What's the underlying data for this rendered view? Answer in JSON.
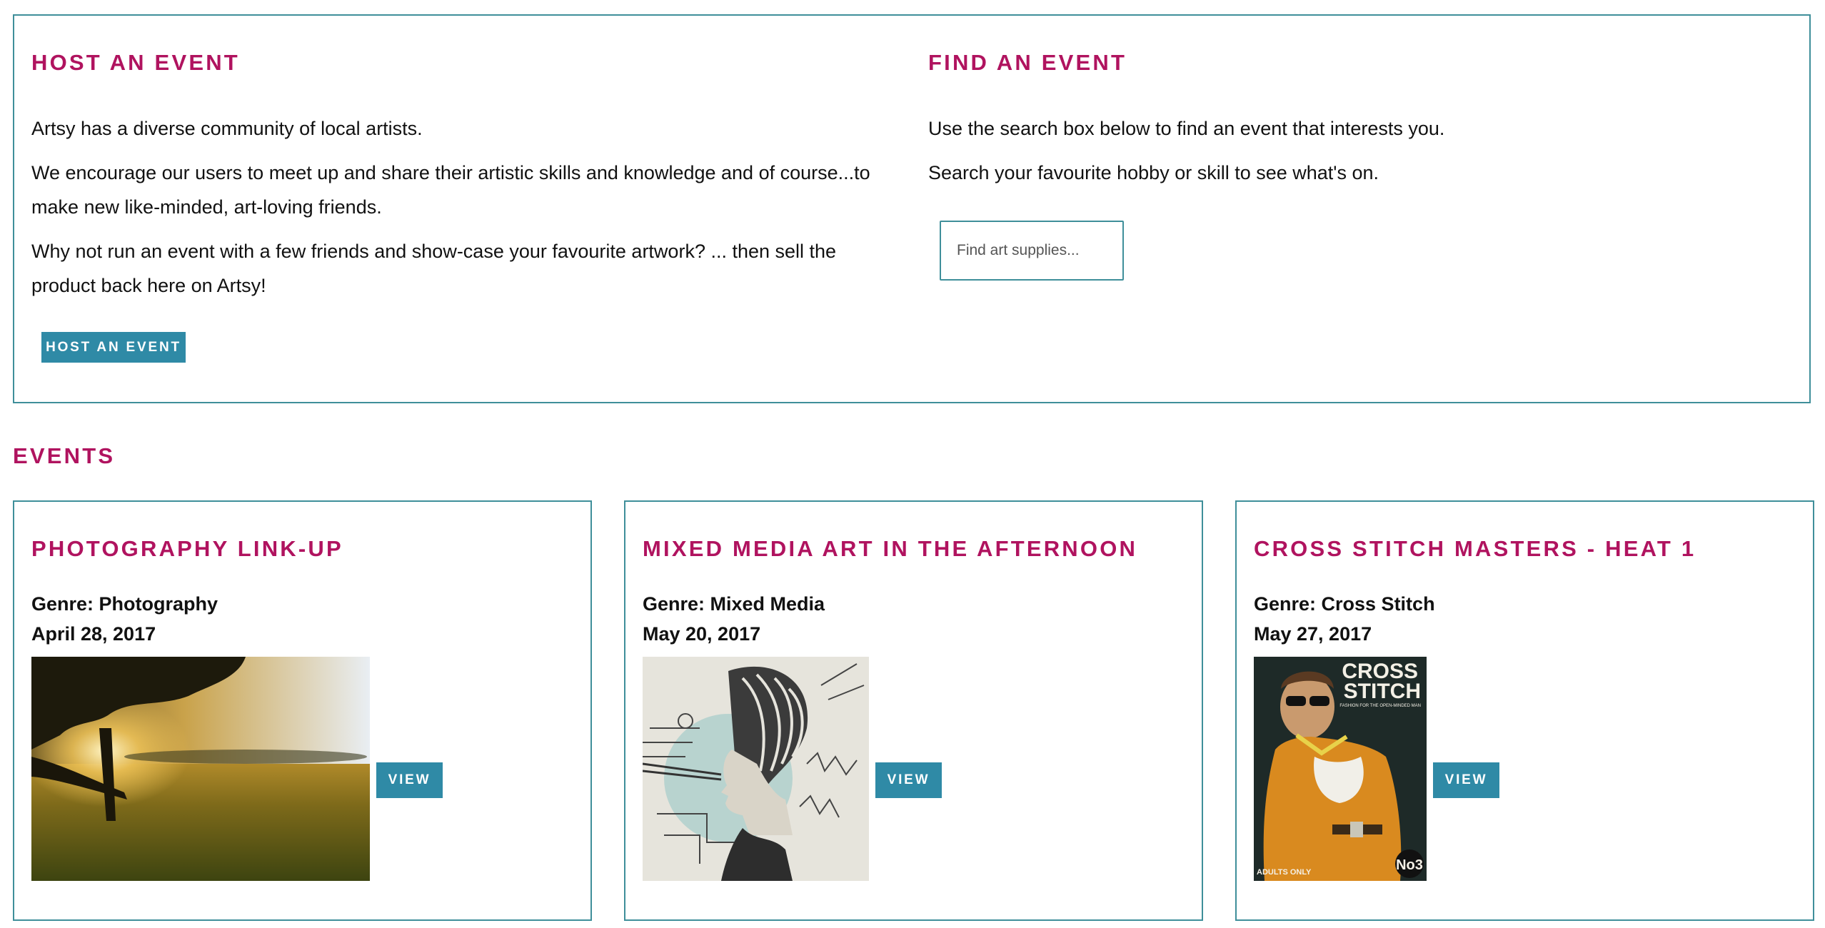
{
  "host": {
    "heading": "HOST AN EVENT",
    "paragraphs": [
      "Artsy has a diverse community of local artists.",
      "We encourage our users to meet up and share their artistic skills and knowledge and of course...to make new like-minded, art-loving friends.",
      "Why not run an event with a few friends and show-case your favourite artwork? ... then sell the product back here on Artsy!"
    ],
    "button_label": "HOST AN EVENT"
  },
  "find": {
    "heading": "FIND AN EVENT",
    "paragraphs": [
      "Use the search box below to find an event that interests you.",
      "Search your favourite hobby or skill to see what's on."
    ],
    "search_placeholder": "Find art supplies..."
  },
  "events": {
    "heading": "EVENTS",
    "items": [
      {
        "title": "PHOTOGRAPHY LINK-UP",
        "genre": "Genre: Photography",
        "date": "April 28, 2017",
        "view_label": "VIEW",
        "image": "golf-course-sunset-photo"
      },
      {
        "title": "MIXED MEDIA ART IN THE AFTERNOON",
        "genre": "Genre: Mixed Media",
        "date": "May 20, 2017",
        "view_label": "VIEW",
        "image": "mixed-media-collage-portrait"
      },
      {
        "title": "CROSS STITCH MASTERS - HEAT 1",
        "genre": "Genre: Cross Stitch",
        "date": "May 27, 2017",
        "view_label": "VIEW",
        "image": "cross-stitch-magazine-cover",
        "cover_title_line1": "CROSS",
        "cover_title_line2": "STITCH",
        "cover_tagline": "FASHION FOR THE OPEN-MINDED MAN",
        "cover_badge": "ADULTS ONLY",
        "cover_number": "No3"
      }
    ]
  },
  "colors": {
    "accent_magenta": "#b0135f",
    "button_teal": "#2f8aa6",
    "border_teal": "#3f8f9a"
  }
}
